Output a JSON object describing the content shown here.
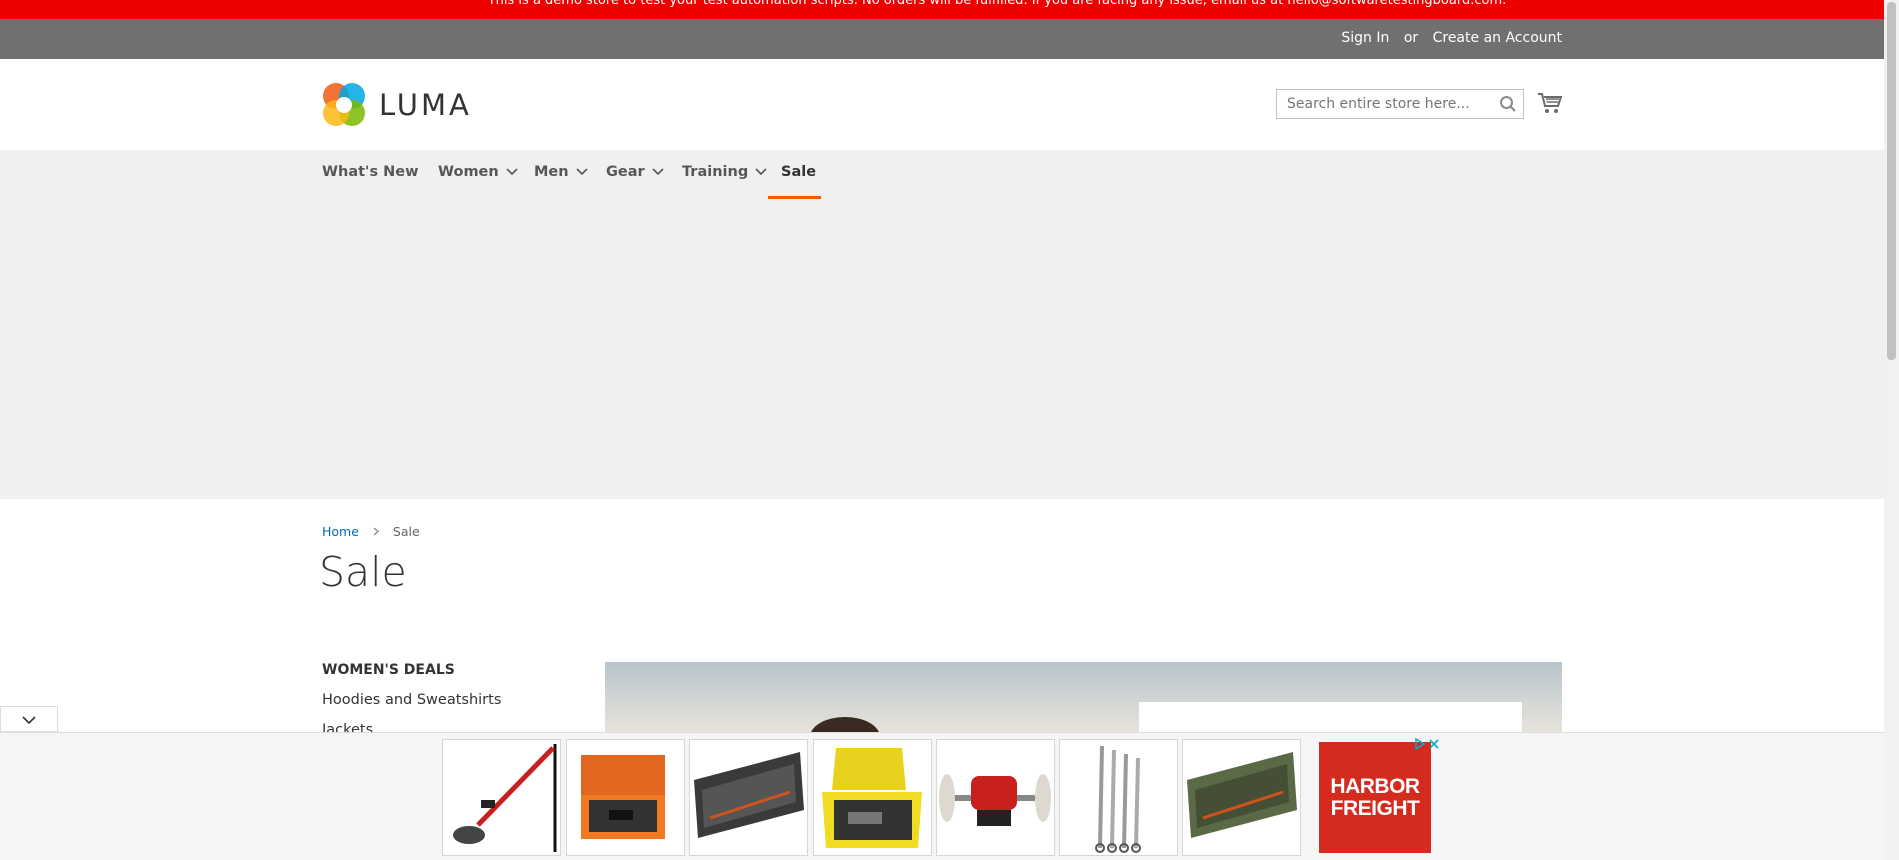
{
  "demo_notice": {
    "text": "This is a demo store to test your test automation scripts. No orders will be fulfilled. If you are facing any issue, email us at hello@softwaretestingboard.com."
  },
  "topbar": {
    "sign_in": "Sign In",
    "or": "or",
    "create_account": "Create an Account"
  },
  "header": {
    "logo_text": "LUMA",
    "search": {
      "placeholder": "Search entire store here..."
    },
    "cart_icon": "cart-icon"
  },
  "nav": {
    "items": [
      {
        "label": "What's New",
        "has_dropdown": false
      },
      {
        "label": "Women",
        "has_dropdown": true
      },
      {
        "label": "Men",
        "has_dropdown": true
      },
      {
        "label": "Gear",
        "has_dropdown": true
      },
      {
        "label": "Training",
        "has_dropdown": true
      },
      {
        "label": "Sale",
        "has_dropdown": false,
        "active": true
      }
    ],
    "active_color": "#ff5501"
  },
  "breadcrumb": {
    "home": "Home",
    "current": "Sale"
  },
  "page": {
    "title": "Sale"
  },
  "sidebar": {
    "title": "WOMEN'S DEALS",
    "items": [
      "Hoodies and Sweatshirts",
      "Jackets"
    ]
  },
  "ad": {
    "brand_line1": "HARBOR",
    "brand_line2": "FREIGHT",
    "brand_color": "#d52b1e",
    "products": [
      "drywall-sander",
      "orange-hard-case",
      "black-rifle-case",
      "yellow-hard-case",
      "bench-buffer",
      "ratcheting-wrenches",
      "green-rifle-case"
    ]
  },
  "colors": {
    "demo_bar": "#ee0000",
    "topbar": "#6e716e",
    "link": "#006bb4"
  }
}
